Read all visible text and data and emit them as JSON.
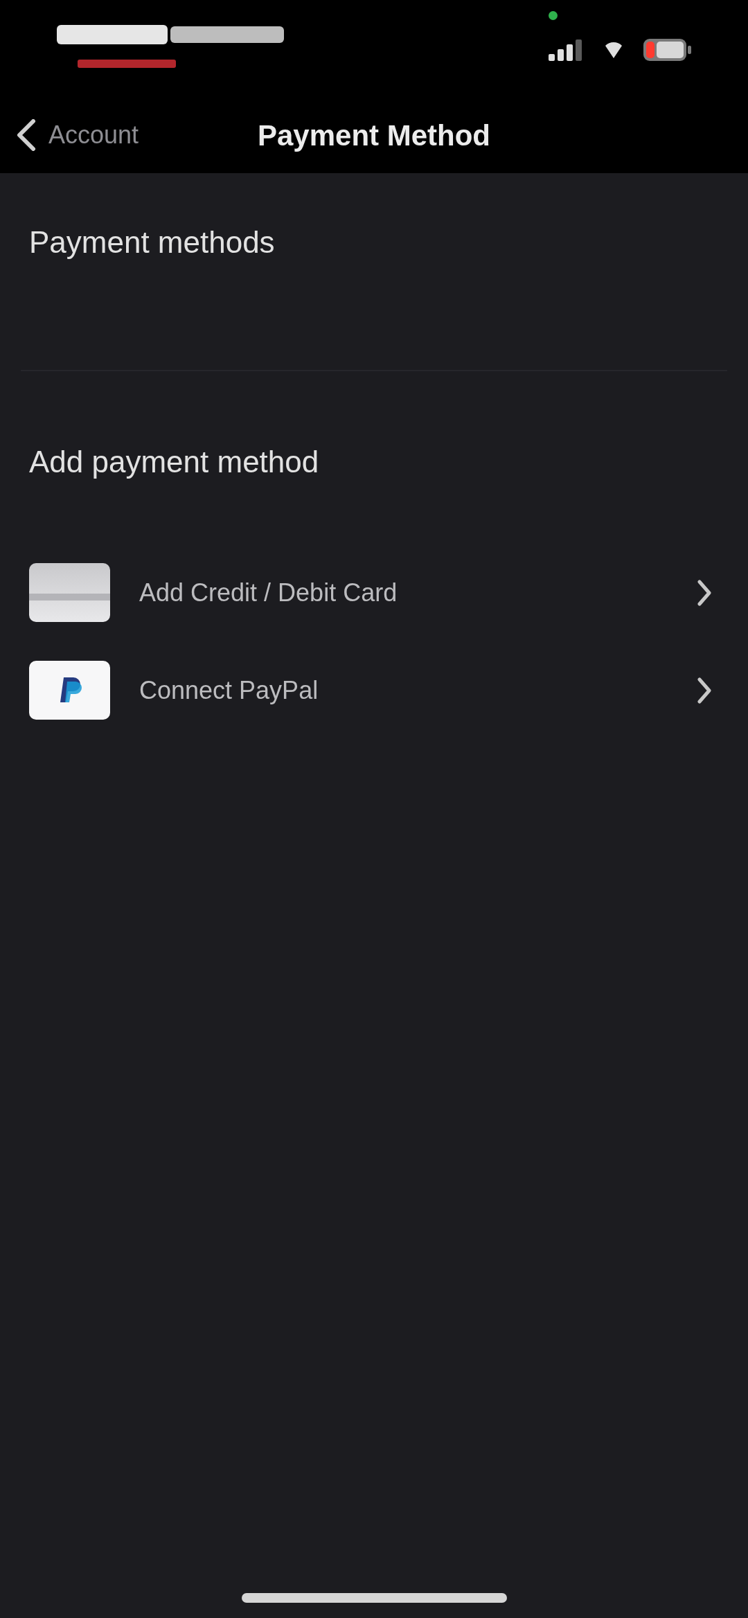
{
  "header": {
    "back_label": "Account",
    "title": "Payment Method"
  },
  "saved_section": {
    "title": "Payment methods"
  },
  "add_section": {
    "title": "Add payment method",
    "options": [
      {
        "kind": "card",
        "label": "Add Credit / Debit Card"
      },
      {
        "kind": "paypal",
        "label": "Connect PayPal"
      }
    ]
  }
}
